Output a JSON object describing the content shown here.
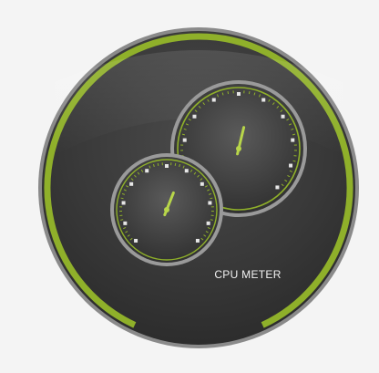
{
  "widget": {
    "title": "CPU METER",
    "colors": {
      "accent": "#8fb02a",
      "accent_light": "#b8d64a",
      "body": "#3a3a3a",
      "body_dark": "#2c2c2c",
      "rim": "#7a7a7a",
      "tick": "#e6e6e6",
      "page_background": "#f4f4f4"
    },
    "overall_usage_arc_percent": 100,
    "gauges": [
      {
        "id": "gauge-large",
        "needle_percent": 55,
        "caption": ""
      },
      {
        "id": "gauge-small",
        "needle_percent": 58,
        "caption": ""
      }
    ],
    "tick_count": 10
  }
}
